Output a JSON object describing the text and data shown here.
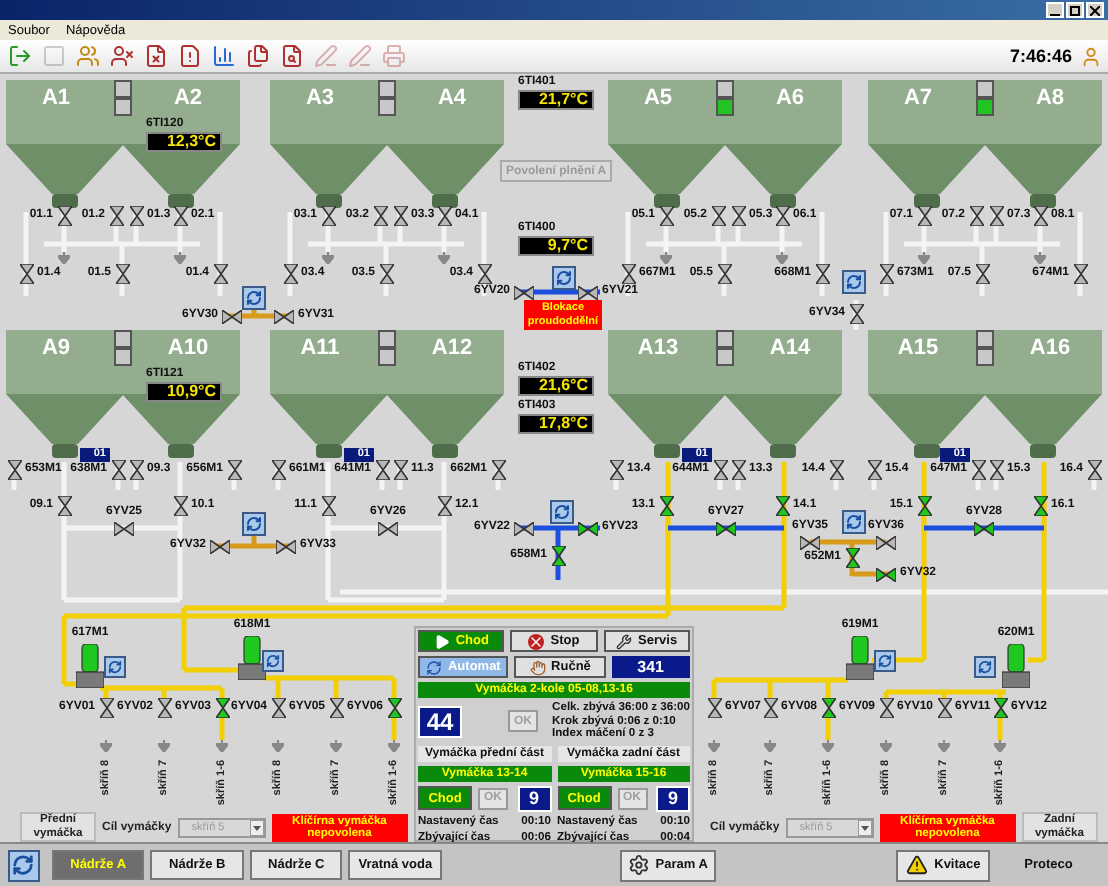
{
  "menu": [
    {
      "label": "Soubor"
    },
    {
      "label": "Nápověda"
    }
  ],
  "toolbar": [
    {
      "kind": "exit",
      "disabled": false
    },
    {
      "kind": "blank",
      "disabled": true
    },
    {
      "kind": "users",
      "disabled": false
    },
    {
      "kind": "user-remove",
      "disabled": false
    },
    {
      "kind": "doc-remove",
      "disabled": false
    },
    {
      "kind": "doc-alert",
      "disabled": false
    },
    {
      "kind": "chart",
      "disabled": false
    },
    {
      "kind": "docs",
      "disabled": false
    },
    {
      "kind": "doc-search",
      "disabled": false
    },
    {
      "kind": "edit",
      "disabled": true
    },
    {
      "kind": "edit",
      "disabled": true
    },
    {
      "kind": "print",
      "disabled": true
    }
  ],
  "clock": "7:46:46",
  "tank_pairs": [
    {
      "tanks": [
        "A1",
        "A2"
      ],
      "filling": false
    },
    {
      "tanks": [
        "A3",
        "A4"
      ],
      "filling": false
    },
    {
      "tanks": [
        "A5",
        "A6"
      ],
      "filling": true
    },
    {
      "tanks": [
        "A7",
        "A8"
      ],
      "filling": true
    },
    {
      "tanks": [
        "A9",
        "A10"
      ],
      "filling": false
    },
    {
      "tanks": [
        "A11",
        "A12"
      ],
      "filling": false
    },
    {
      "tanks": [
        "A13",
        "A14"
      ],
      "filling": false
    },
    {
      "tanks": [
        "A15",
        "A16"
      ],
      "filling": false
    }
  ],
  "temperatures": [
    {
      "tag": "6TI401",
      "value": "21,7°C"
    },
    {
      "tag": "6TI120",
      "value": "12,3°C"
    },
    {
      "tag": "6TI400",
      "value": "9,7°C"
    },
    {
      "tag": "6TI121",
      "value": "10,9°C"
    },
    {
      "tag": "6TI402",
      "value": "21,6°C"
    },
    {
      "tag": "6TI403",
      "value": "17,8°C"
    }
  ],
  "permit_button": {
    "label": "Povolení plnění A",
    "disabled": true
  },
  "blocking_alarm": "Blokace proudoddělní",
  "level_badges": [
    "01",
    "01",
    "01",
    "01"
  ],
  "valves": [
    {
      "label": "01.1",
      "open": false
    },
    {
      "label": "01.2",
      "open": false
    },
    {
      "label": "01.3",
      "open": false
    },
    {
      "label": "02.1",
      "open": false
    },
    {
      "label": "01.4",
      "open": false
    },
    {
      "label": "01.5",
      "open": false
    },
    {
      "label": "01.4",
      "open": false
    },
    {
      "label": "03.1",
      "open": false
    },
    {
      "label": "03.2",
      "open": false
    },
    {
      "label": "03.3",
      "open": false
    },
    {
      "label": "04.1",
      "open": false
    },
    {
      "label": "03.4",
      "open": false
    },
    {
      "label": "03.5",
      "open": false
    },
    {
      "label": "03.4",
      "open": false
    },
    {
      "label": "05.1",
      "open": false
    },
    {
      "label": "05.2",
      "open": false
    },
    {
      "label": "05.3",
      "open": false
    },
    {
      "label": "06.1",
      "open": false
    },
    {
      "label": "667M1",
      "open": false
    },
    {
      "label": "05.5",
      "open": false
    },
    {
      "label": "668M1",
      "open": false
    },
    {
      "label": "07.1",
      "open": false
    },
    {
      "label": "07.2",
      "open": false
    },
    {
      "label": "07.3",
      "open": false
    },
    {
      "label": "08.1",
      "open": false
    },
    {
      "label": "673M1",
      "open": false
    },
    {
      "label": "07.5",
      "open": false
    },
    {
      "label": "674M1",
      "open": false
    },
    {
      "label": "653M1",
      "open": false
    },
    {
      "label": "638M1",
      "open": false
    },
    {
      "label": "09.3",
      "open": false
    },
    {
      "label": "656M1",
      "open": false
    },
    {
      "label": "09.1",
      "open": false
    },
    {
      "label": "10.1",
      "open": false
    },
    {
      "label": "6YV25",
      "open": false
    },
    {
      "label": "661M1",
      "open": false
    },
    {
      "label": "641M1",
      "open": false
    },
    {
      "label": "11.3",
      "open": false
    },
    {
      "label": "662M1",
      "open": false
    },
    {
      "label": "11.1",
      "open": false
    },
    {
      "label": "12.1",
      "open": false
    },
    {
      "label": "6YV26",
      "open": false
    },
    {
      "label": "13.4",
      "open": false
    },
    {
      "label": "644M1",
      "open": false
    },
    {
      "label": "13.3",
      "open": false
    },
    {
      "label": "14.4",
      "open": false
    },
    {
      "label": "13.1",
      "open": true
    },
    {
      "label": "14.1",
      "open": true
    },
    {
      "label": "6YV27",
      "open": true
    },
    {
      "label": "15.4",
      "open": false
    },
    {
      "label": "647M1",
      "open": false
    },
    {
      "label": "15.3",
      "open": false
    },
    {
      "label": "16.4",
      "open": false
    },
    {
      "label": "15.1",
      "open": true
    },
    {
      "label": "16.1",
      "open": true
    },
    {
      "label": "6YV28",
      "open": true
    },
    {
      "label": "6YV30",
      "open": false
    },
    {
      "label": "6YV31",
      "open": false
    },
    {
      "label": "6YV20",
      "open": false
    },
    {
      "label": "6YV21",
      "open": false
    },
    {
      "label": "6YV34",
      "open": false
    },
    {
      "label": "6YV32",
      "open": false
    },
    {
      "label": "6YV33",
      "open": false
    },
    {
      "label": "6YV22",
      "open": false
    },
    {
      "label": "6YV23",
      "open": true
    },
    {
      "label": "658M1",
      "open": true
    },
    {
      "label": "6YV35",
      "open": false
    },
    {
      "label": "6YV36",
      "open": false
    },
    {
      "label": "652M1",
      "open": true
    },
    {
      "label": "6YV32",
      "open": true
    },
    {
      "label": "6YV01",
      "open": false
    },
    {
      "label": "6YV02",
      "open": false
    },
    {
      "label": "6YV03",
      "open": true
    },
    {
      "label": "6YV04",
      "open": false
    },
    {
      "label": "6YV05",
      "open": false
    },
    {
      "label": "6YV06",
      "open": true
    },
    {
      "label": "6YV07",
      "open": false
    },
    {
      "label": "6YV08",
      "open": false
    },
    {
      "label": "6YV09",
      "open": true
    },
    {
      "label": "6YV10",
      "open": false
    },
    {
      "label": "6YV11",
      "open": false
    },
    {
      "label": "6YV12",
      "open": true
    }
  ],
  "pumps": [
    {
      "label": "617M1",
      "running": true
    },
    {
      "label": "618M1",
      "running": true
    },
    {
      "label": "619M1",
      "running": true
    },
    {
      "label": "620M1",
      "running": true
    }
  ],
  "outlets": [
    "skříň 8",
    "skříň 7",
    "skříň 1-6",
    "skříň 8",
    "skříň 7",
    "skříň 1-6",
    "skříň 8",
    "skříň 7",
    "skříň 1-6",
    "skříň 8",
    "skříň 7",
    "skříň 1-6"
  ],
  "control_panel": {
    "mode_buttons": [
      {
        "label": "Chod",
        "kind": "run",
        "active": true
      },
      {
        "label": "Stop",
        "kind": "stop",
        "active": false
      },
      {
        "label": "Servis",
        "kind": "service",
        "active": false
      },
      {
        "label": "Automat",
        "kind": "auto",
        "active": true
      },
      {
        "label": "Ručně",
        "kind": "manual",
        "active": false
      }
    ],
    "counter": "341",
    "program": "Vymáčka 2-kole 05-08,13-16",
    "step": "44",
    "ok": {
      "label": "OK",
      "disabled": true
    },
    "status_lines": [
      "Celk. zbývá 36:00 z 36:00",
      "Krok zbývá 0:06 z 0:10",
      "Index máčení 0 z 3"
    ],
    "sections": [
      {
        "title": "Vymáčka přední část",
        "program": "Vymáčka 13-14",
        "run": {
          "label": "Chod",
          "active": true
        },
        "ok": {
          "label": "OK",
          "disabled": true
        },
        "count": "9",
        "times": [
          {
            "label": "Nastavený čas",
            "value": "00:10"
          },
          {
            "label": "Zbývající čas",
            "value": "00:06"
          }
        ]
      },
      {
        "title": "Vymáčka zadní část",
        "program": "Vymáčka 15-16",
        "run": {
          "label": "Chod",
          "active": true
        },
        "ok": {
          "label": "OK",
          "disabled": true
        },
        "count": "9",
        "times": [
          {
            "label": "Nastavený čas",
            "value": "00:10"
          },
          {
            "label": "Zbývající čas",
            "value": "00:04"
          }
        ]
      }
    ]
  },
  "soak_targets": [
    {
      "side_label": "Přední vymáčka",
      "target_label": "Cíl vymáčky",
      "target": "skříň 5",
      "target_disabled": true,
      "alarm": "Klíčírna vymáčka nepovolena"
    },
    {
      "side_label": "Zadní vymáčka",
      "target_label": "Cíl vymáčky",
      "target": "skříň 5",
      "target_disabled": true,
      "alarm": "Klíčírna vymáčka nepovolena"
    }
  ],
  "tabs": [
    {
      "label": "Nádrže A",
      "selected": true
    },
    {
      "label": "Nádrže B",
      "selected": false
    },
    {
      "label": "Nádrže C",
      "selected": false
    },
    {
      "label": "Vratná voda",
      "selected": false
    }
  ],
  "bottom_buttons": [
    {
      "label": "Param A",
      "kind": "param"
    },
    {
      "label": "Kvitace",
      "kind": "alert"
    },
    {
      "label": "Proteco",
      "kind": "plain"
    }
  ]
}
